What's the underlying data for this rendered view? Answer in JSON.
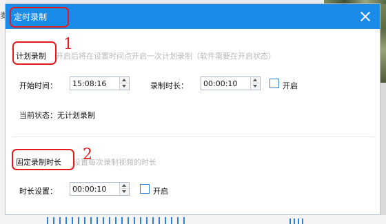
{
  "dialog": {
    "title": "定时录制"
  },
  "scheduled": {
    "section_title": "计划录制",
    "hint": "开启后将在设置时间点开启一次计划录制（软件需要在开启状态）",
    "start_time_label": "开始时间：",
    "start_time_value": "15:08:16",
    "duration_label": "录制时长：",
    "duration_value": "00:00:10",
    "enable_label": "开启",
    "status_text": "当前状态：无计划录制"
  },
  "fixed": {
    "section_title": "固定录制时长",
    "hint": "设置每次录制视频的时长",
    "duration_label": "时长设置：",
    "duration_value": "00:00:10",
    "enable_label": "开启"
  },
  "annotations": {
    "marker_1": "1",
    "marker_2": "2",
    "color": "#e41a1c"
  },
  "background": {
    "partial_text": "麦"
  }
}
